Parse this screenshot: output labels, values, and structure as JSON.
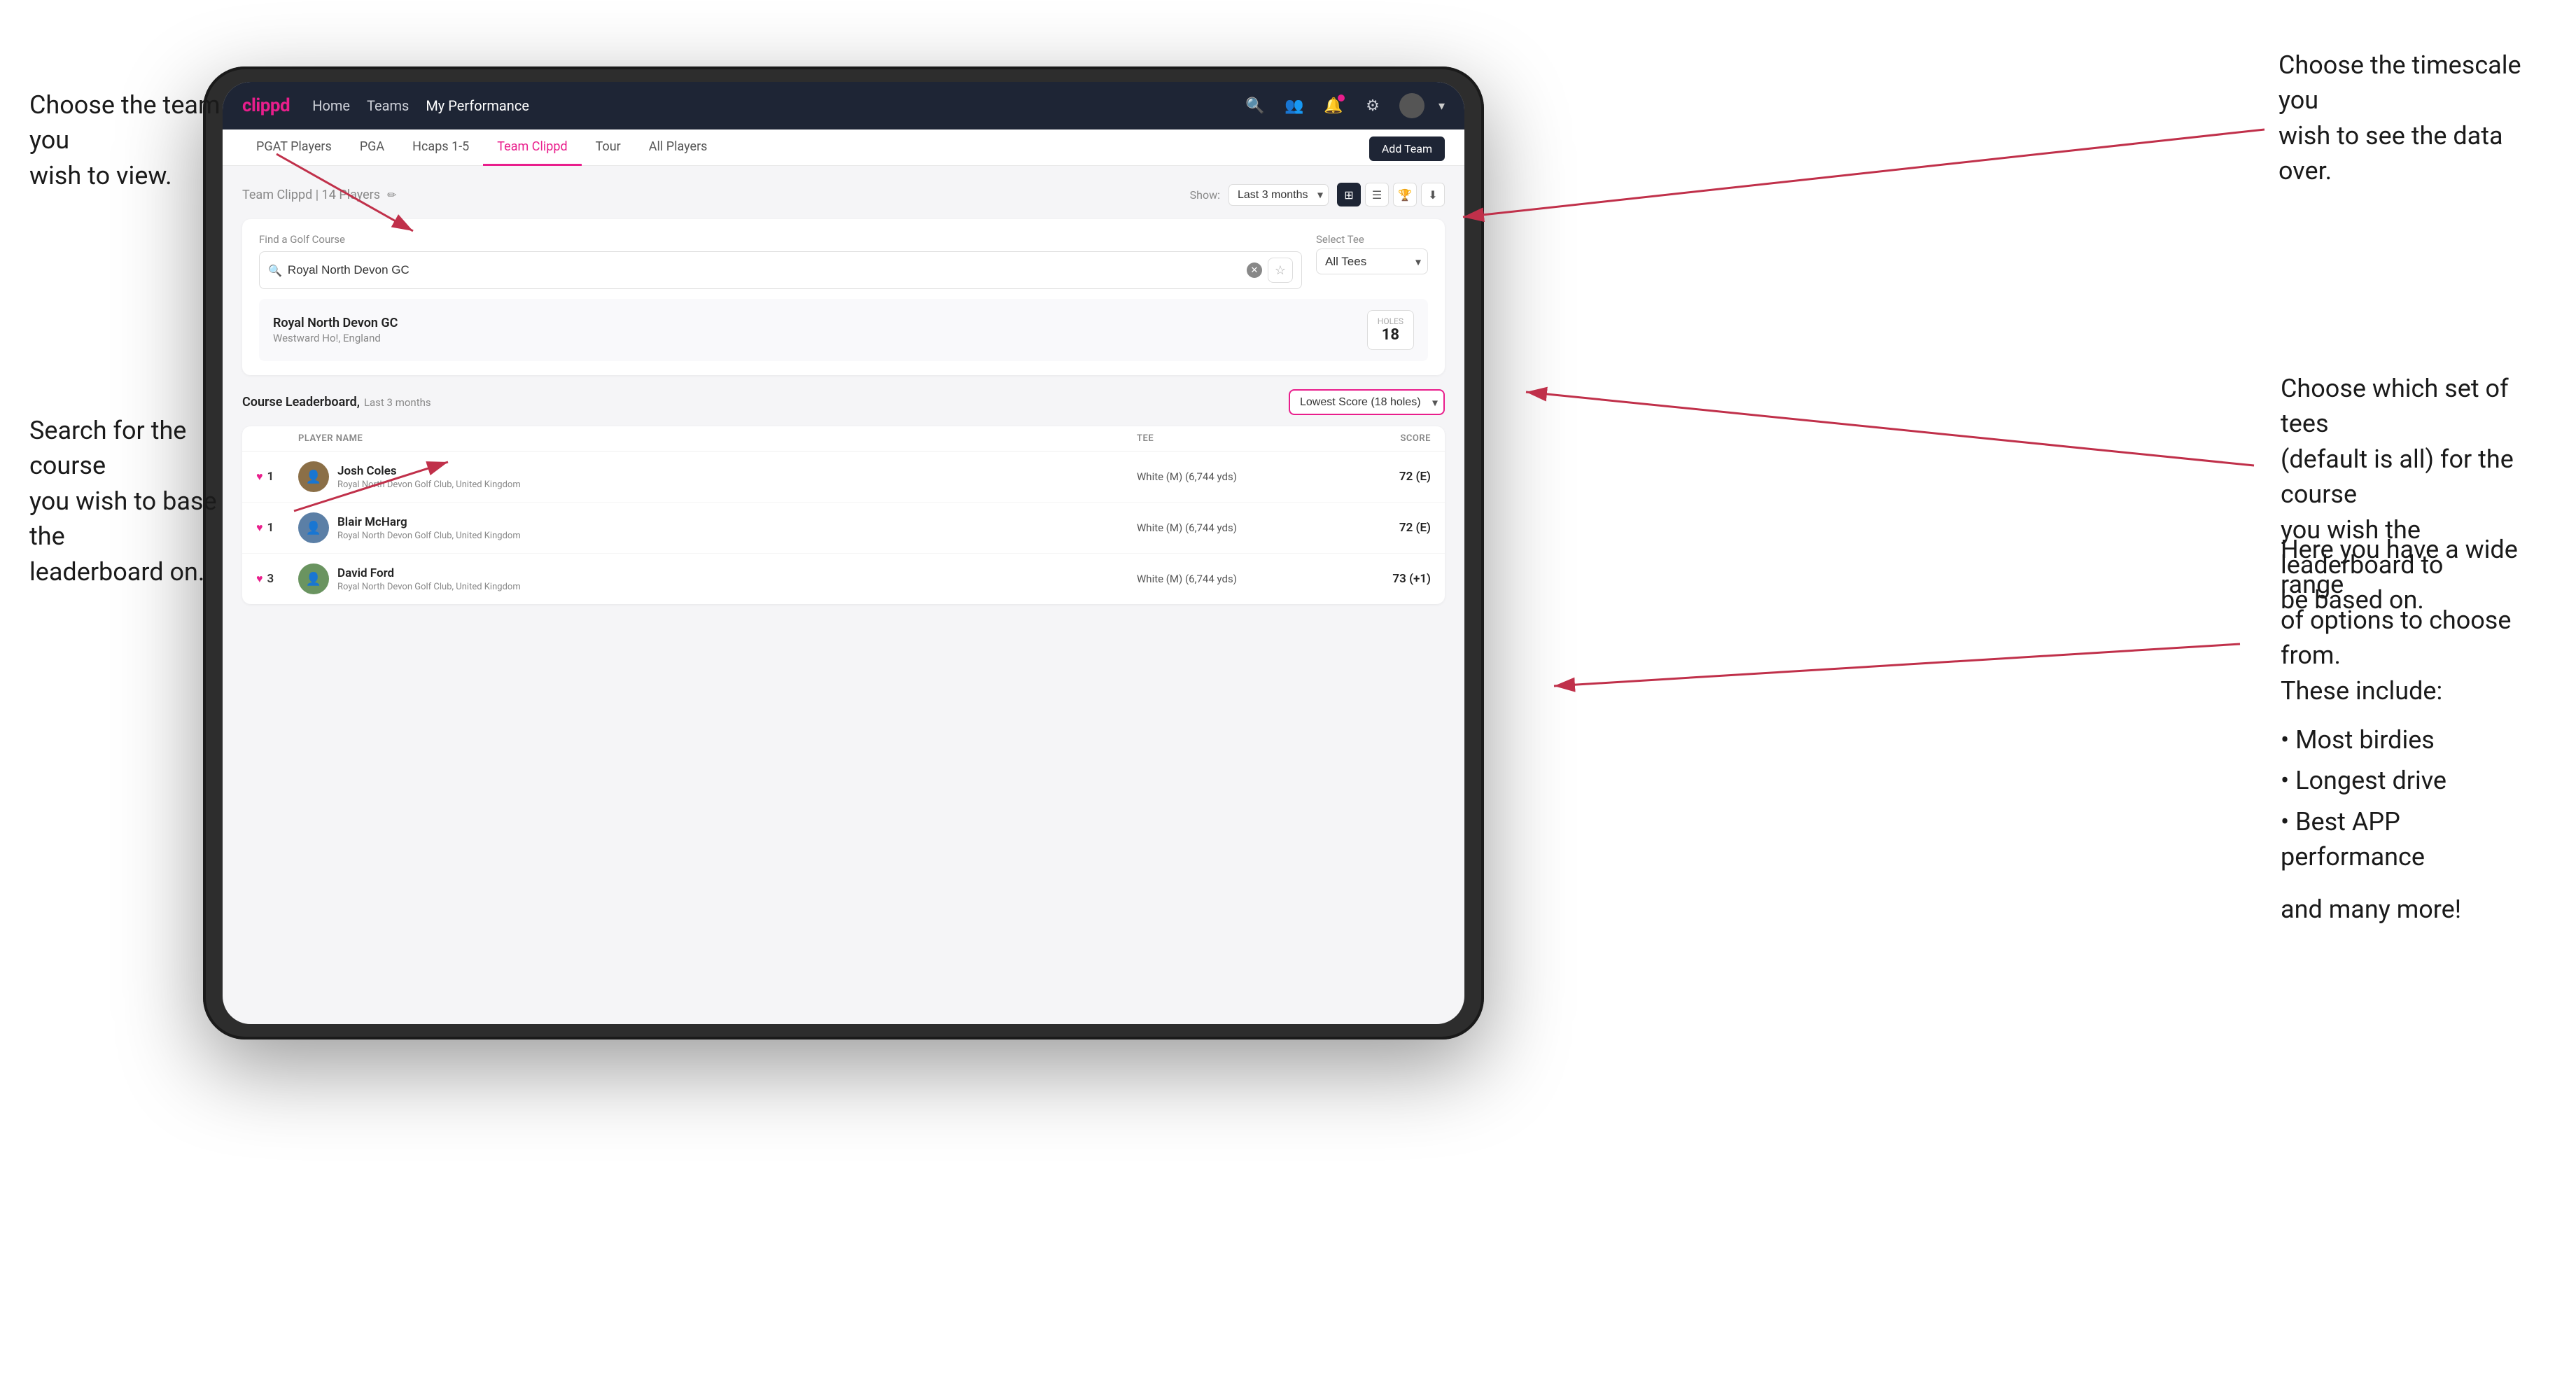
{
  "annotations": {
    "top_left": {
      "text": "Choose the team you\nwish to view."
    },
    "top_right": {
      "text": "Choose the timescale you\nwish to see the data over."
    },
    "mid_right": {
      "text": "Choose which set of tees\n(default is all) for the course\nyou wish the leaderboard to\nbe based on."
    },
    "mid_left": {
      "text": "Search for the course\nyou wish to base the\nleaderboard on."
    },
    "bottom_right": {
      "title": "Here you have a wide range\nof options to choose from.\nThese include:",
      "bullets": [
        "Most birdies",
        "Longest drive",
        "Best APP performance"
      ],
      "footer": "and many more!"
    }
  },
  "navbar": {
    "logo": "clippd",
    "links": [
      "Home",
      "Teams",
      "My Performance"
    ],
    "active_link": "My Performance"
  },
  "sub_nav": {
    "tabs": [
      "PGAT Players",
      "PGA",
      "Hcaps 1-5",
      "Team Clippd",
      "Tour",
      "All Players"
    ],
    "active_tab": "Team Clippd",
    "add_team_label": "Add Team"
  },
  "team_header": {
    "name": "Team Clippd",
    "count": "14 Players",
    "show_label": "Show:",
    "show_value": "Last 3 months"
  },
  "course_search": {
    "find_label": "Find a Golf Course",
    "search_placeholder": "Royal North Devon GC",
    "tee_label": "Select Tee",
    "tee_value": "All Tees"
  },
  "course_result": {
    "name": "Royal North Devon GC",
    "location": "Westward Ho!, England",
    "holes_label": "Holes",
    "holes_value": "18"
  },
  "leaderboard": {
    "title": "Course Leaderboard,",
    "subtitle": "Last 3 months",
    "score_type": "Lowest Score (18 holes)",
    "col_headers": [
      "",
      "PLAYER NAME",
      "TEE",
      "SCORE"
    ],
    "players": [
      {
        "rank": "1",
        "name": "Josh Coles",
        "club": "Royal North Devon Golf Club, United Kingdom",
        "tee": "White (M) (6,744 yds)",
        "score": "72 (E)"
      },
      {
        "rank": "1",
        "name": "Blair McHarg",
        "club": "Royal North Devon Golf Club, United Kingdom",
        "tee": "White (M) (6,744 yds)",
        "score": "72 (E)"
      },
      {
        "rank": "3",
        "name": "David Ford",
        "club": "Royal North Devon Golf Club, United Kingdom",
        "tee": "White (M) (6,744 yds)",
        "score": "73 (+1)"
      }
    ]
  },
  "icons": {
    "search": "🔍",
    "settings": "⚙",
    "notification": "🔔",
    "person": "👤",
    "chevron_down": "▾",
    "grid": "⊞",
    "list": "☰",
    "trophy": "🏆",
    "download": "⬇",
    "edit": "✏",
    "star": "☆",
    "heart": "♥"
  }
}
